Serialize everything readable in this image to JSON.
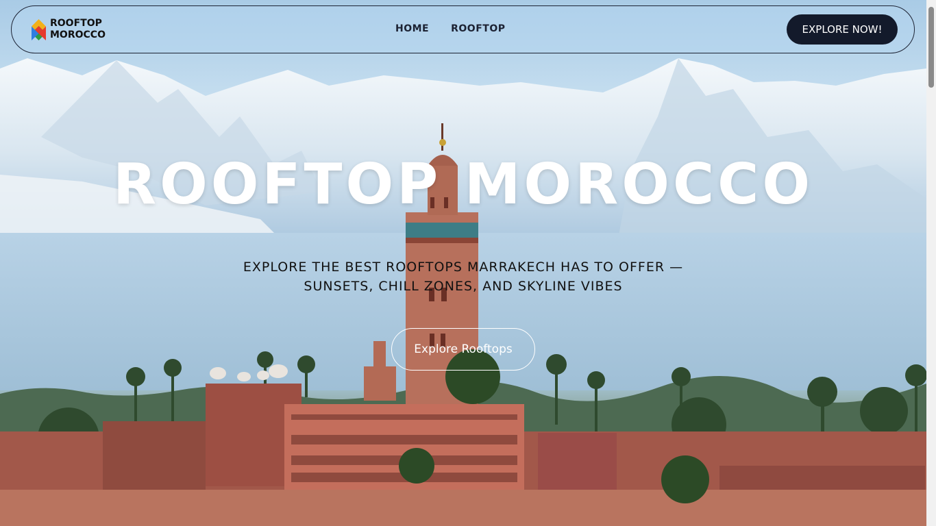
{
  "brand": {
    "line1": "ROOFTOP",
    "line2": "MOROCCO",
    "logo_icon": "moroccan-star-logo-icon",
    "colors": [
      "#e63a2e",
      "#f2b11a",
      "#2e9b44",
      "#2f7de1"
    ]
  },
  "nav": {
    "links": [
      "HOME",
      "ROOFTOP"
    ],
    "cta_label": "EXPLORE NOW!"
  },
  "hero": {
    "title": "ROOFTOP MOROCCO",
    "subtitle_line1": "EXPLORE THE BEST ROOFTOPS MARRAKECH HAS TO OFFER —",
    "subtitle_line2": "SUNSETS, CHILL ZONES, AND SKYLINE VIBES",
    "button_label": "Explore Rooftops"
  },
  "colors": {
    "navbar_border": "#1c2233",
    "cta_bg": "#131a2b",
    "title": "#ffffff"
  }
}
